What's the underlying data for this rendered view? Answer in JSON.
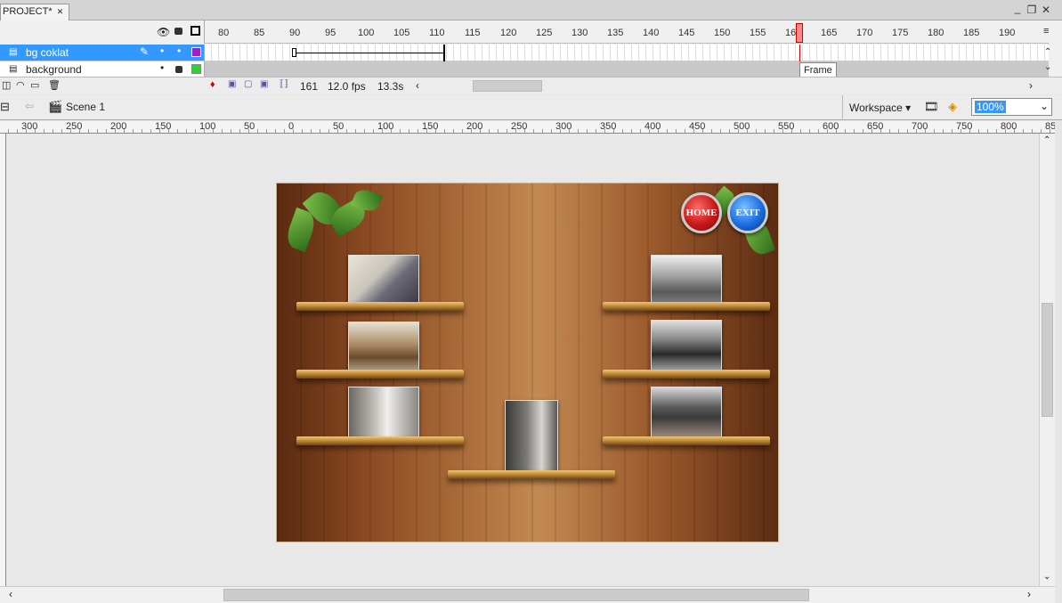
{
  "document_tab": {
    "label": "PROJECT*"
  },
  "window_controls": {
    "restore": "❐",
    "close": "✕"
  },
  "timeline": {
    "frame_ruler": [
      "80",
      "85",
      "90",
      "95",
      "100",
      "105",
      "110",
      "115",
      "120",
      "125",
      "130",
      "135",
      "140",
      "145",
      "150",
      "155",
      "160",
      "165",
      "170",
      "175",
      "180",
      "185",
      "190"
    ],
    "layers": [
      {
        "name": "bg coklat",
        "selected": true,
        "color": "#a020c0"
      },
      {
        "name": "background",
        "selected": false,
        "color": "#30d030"
      }
    ],
    "current_frame": "161",
    "fps": "12.0 fps",
    "time": "13.3s",
    "tooltip": "Frame"
  },
  "edit_bar": {
    "scene": "Scene 1",
    "workspace": "Workspace",
    "zoom": "100%"
  },
  "stage_ruler": [
    "300",
    "250",
    "200",
    "150",
    "100",
    "50",
    "0",
    "50",
    "100",
    "150",
    "200",
    "250",
    "300",
    "350",
    "400",
    "450",
    "500",
    "550",
    "600",
    "650",
    "700",
    "750",
    "800",
    "850"
  ],
  "stage": {
    "home_button": "HOME",
    "exit_button": "EXIT",
    "colors": {
      "home": "#c81818",
      "exit": "#1a6ee0"
    }
  }
}
